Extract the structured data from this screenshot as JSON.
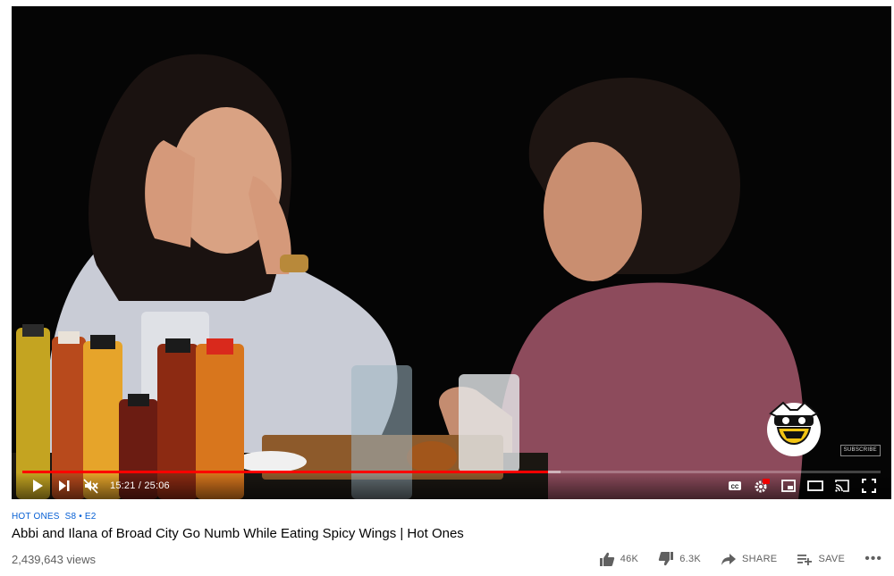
{
  "video": {
    "time_current": "15:21",
    "time_separator": "/",
    "time_total": "25:06",
    "progress_fraction": 0.612,
    "buffered_fraction": 0.627,
    "subscribe_badge": "SUBSCRIBE",
    "controls": {
      "play_icon": "play-icon",
      "next_icon": "next-icon",
      "mute_icon": "volume-muted-icon",
      "cc_icon": "captions-icon",
      "settings_icon": "settings-hd-icon",
      "miniplayer_icon": "miniplayer-icon",
      "theater_icon": "theater-mode-icon",
      "cast_icon": "cast-icon",
      "fullscreen_icon": "fullscreen-icon"
    },
    "colors": {
      "progress": "#ff0000",
      "background": "#000000"
    }
  },
  "info": {
    "channel_tag": "HOT ONES",
    "episode_tag": "S8 • E2",
    "title": "Abbi and Ilana of Broad City Go Numb While Eating Spicy Wings | Hot Ones",
    "views": "2,439,643 views"
  },
  "actions": {
    "like_count": "46K",
    "dislike_count": "6.3K",
    "share_label": "SHARE",
    "save_label": "SAVE",
    "more_label": "•••"
  }
}
